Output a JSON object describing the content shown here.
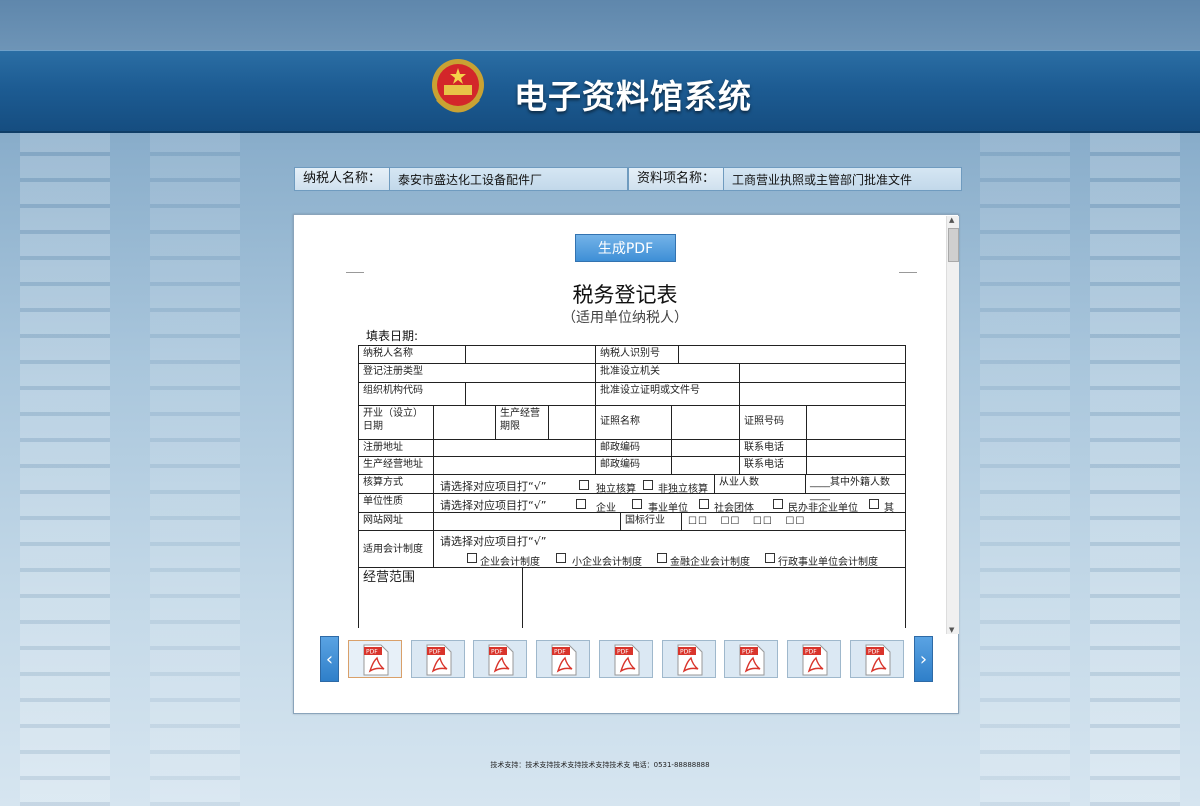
{
  "app": {
    "title": "电子资料馆系统"
  },
  "info": {
    "taxpayer_label": "纳税人名称：",
    "taxpayer_value": "泰安市盛达化工设备配件厂",
    "item_label": "资料项名称：",
    "item_value": "工商营业执照或主管部门批准文件"
  },
  "toolbar": {
    "pdf_button": "生成PDF"
  },
  "document": {
    "title": "税务登记表",
    "subtitle": "（适用单位纳税人）",
    "fill_date": "填表日期:",
    "rows": {
      "r1_a": "纳税人名称",
      "r1_b": "纳税人识别号",
      "r2_a": "登记注册类型",
      "r2_b": "批准设立机关",
      "r3_a": "组织机构代码",
      "r3_b": "批准设立证明或文件号",
      "r4_a": "开业（设立）日期",
      "r4_b": "生产经营期限",
      "r4_c": "证照名称",
      "r4_d": "证照号码",
      "r5_a": "注册地址",
      "r5_b": "邮政编码",
      "r5_c": "联系电话",
      "r6_a": "生产经营地址",
      "r6_b": "邮政编码",
      "r6_c": "联系电话",
      "r7_a": "核算方式",
      "r7_b": "请选择对应项目打“√”",
      "r7_opt1": "独立核算",
      "r7_opt2": "非独立核算",
      "r7_c": "从业人数",
      "r7_d": "____其中外籍人数____",
      "r8_a": "单位性质",
      "r8_b": "请选择对应项目打“√”",
      "r8_opt1": "企业",
      "r8_opt2": "事业单位",
      "r8_opt3": "社会团体",
      "r8_opt4": "民办非企业单位",
      "r8_opt5": "其",
      "r9_a": "网站网址",
      "r9_b": "国标行业",
      "r10_a": "适用会计制度",
      "r10_b": "请选择对应项目打“√”",
      "r10_opt1": "企业会计制度",
      "r10_opt2": "小企业会计制度",
      "r10_opt3": "金融企业会计制度",
      "r10_opt4": "行政事业单位会计制度",
      "r11_a": "经营范围"
    }
  },
  "thumbnails": {
    "count": 9,
    "active_index": 0,
    "icon": "pdf-file-icon"
  },
  "footer": {
    "text": "技术支持：技术支持技术支持技术支持技术支   电话：0531-88888888"
  },
  "colors": {
    "header": "#1d5c93",
    "accent": "#3e8fd6",
    "pdf_red": "#d9342b"
  }
}
